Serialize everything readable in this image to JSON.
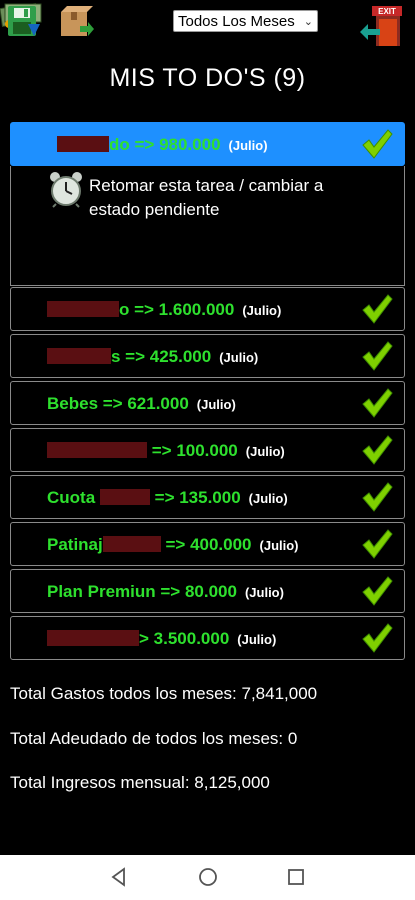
{
  "toolbar": {
    "month_filter": "Todos Los Meses",
    "exit_label": "EXIT"
  },
  "page_title": "MIS TO DO'S (9)",
  "todos": [
    {
      "label_pre": "",
      "label_post": "do => 980.000",
      "month": "(Julio)"
    },
    {
      "label_pre": "",
      "label_post": "o => 1.600.000",
      "month": "(Julio)"
    },
    {
      "label_pre": "",
      "label_post": "s => 425.000",
      "month": "(Julio)"
    },
    {
      "label_pre": "Bebes => 621.000",
      "label_post": "",
      "month": "(Julio)"
    },
    {
      "label_pre": "",
      "label_post": "=> 100.000",
      "month": "(Julio)"
    },
    {
      "label_pre": "Cuota",
      "label_post": "=> 135.000",
      "month": "(Julio)"
    },
    {
      "label_pre": "Patinaj",
      "label_post": "=> 400.000",
      "month": "(Julio)"
    },
    {
      "label_pre": "Plan Premiun => 80.000",
      "label_post": "",
      "month": "(Julio)"
    },
    {
      "label_pre": "",
      "label_post": "> 3.500.000",
      "month": "(Julio)"
    }
  ],
  "expanded_action": "Retomar esta tarea / cambiar a estado pendiente",
  "totals": {
    "gastos": "Total Gastos todos los meses: 7,841,000",
    "adeudado": "Total Adeudado de todos los meses: 0",
    "ingresos": "Total Ingresos mensual: 8,125,000"
  },
  "colors": {
    "selected_row": "#1e90ff",
    "todo_text": "#2ee02e",
    "background": "#000000"
  },
  "icons": [
    "save-icon",
    "import-icon",
    "money-icon",
    "exit-icon",
    "check-icon",
    "alarm-clock-icon",
    "back-icon",
    "home-icon",
    "recents-icon"
  ]
}
